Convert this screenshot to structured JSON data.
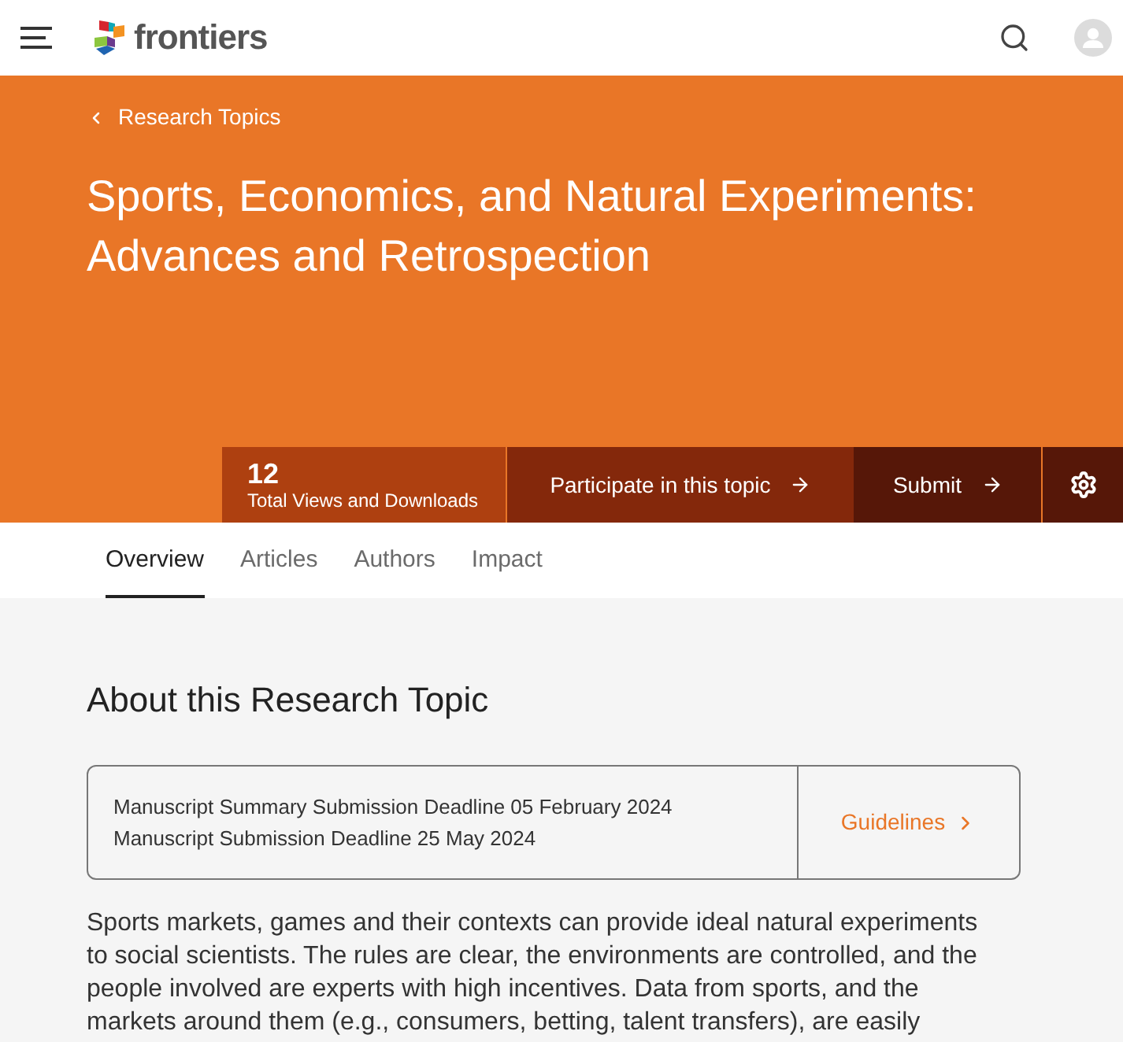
{
  "header": {
    "logo_text": "frontiers"
  },
  "hero": {
    "breadcrumb": "Research Topics",
    "title": "Sports, Economics, and Natural Experiments: Advances and Retrospection"
  },
  "stats": {
    "count": "12",
    "label": "Total Views and Downloads"
  },
  "actions": [
    {
      "kind": "participate",
      "label": "Participate in this topic"
    },
    {
      "kind": "submit",
      "label": "Submit"
    }
  ],
  "tabs": [
    {
      "label": "Overview",
      "selected": true
    },
    {
      "label": "Articles",
      "selected": false
    },
    {
      "label": "Authors",
      "selected": false
    },
    {
      "label": "Impact",
      "selected": false
    }
  ],
  "section_title": "About this Research Topic",
  "deadlines": [
    "Manuscript Summary Submission Deadline 05 February 2024",
    "Manuscript Submission Deadline 25 May 2024"
  ],
  "guidelines_link": "Guidelines",
  "description": "Sports markets, games and their contexts can provide ideal natural experiments to social scientists. The rules are clear, the environments are controlled, and the people involved are experts with high incentives. Data from sports, and the markets around them (e.g., consumers, betting, talent transfers), are easily"
}
